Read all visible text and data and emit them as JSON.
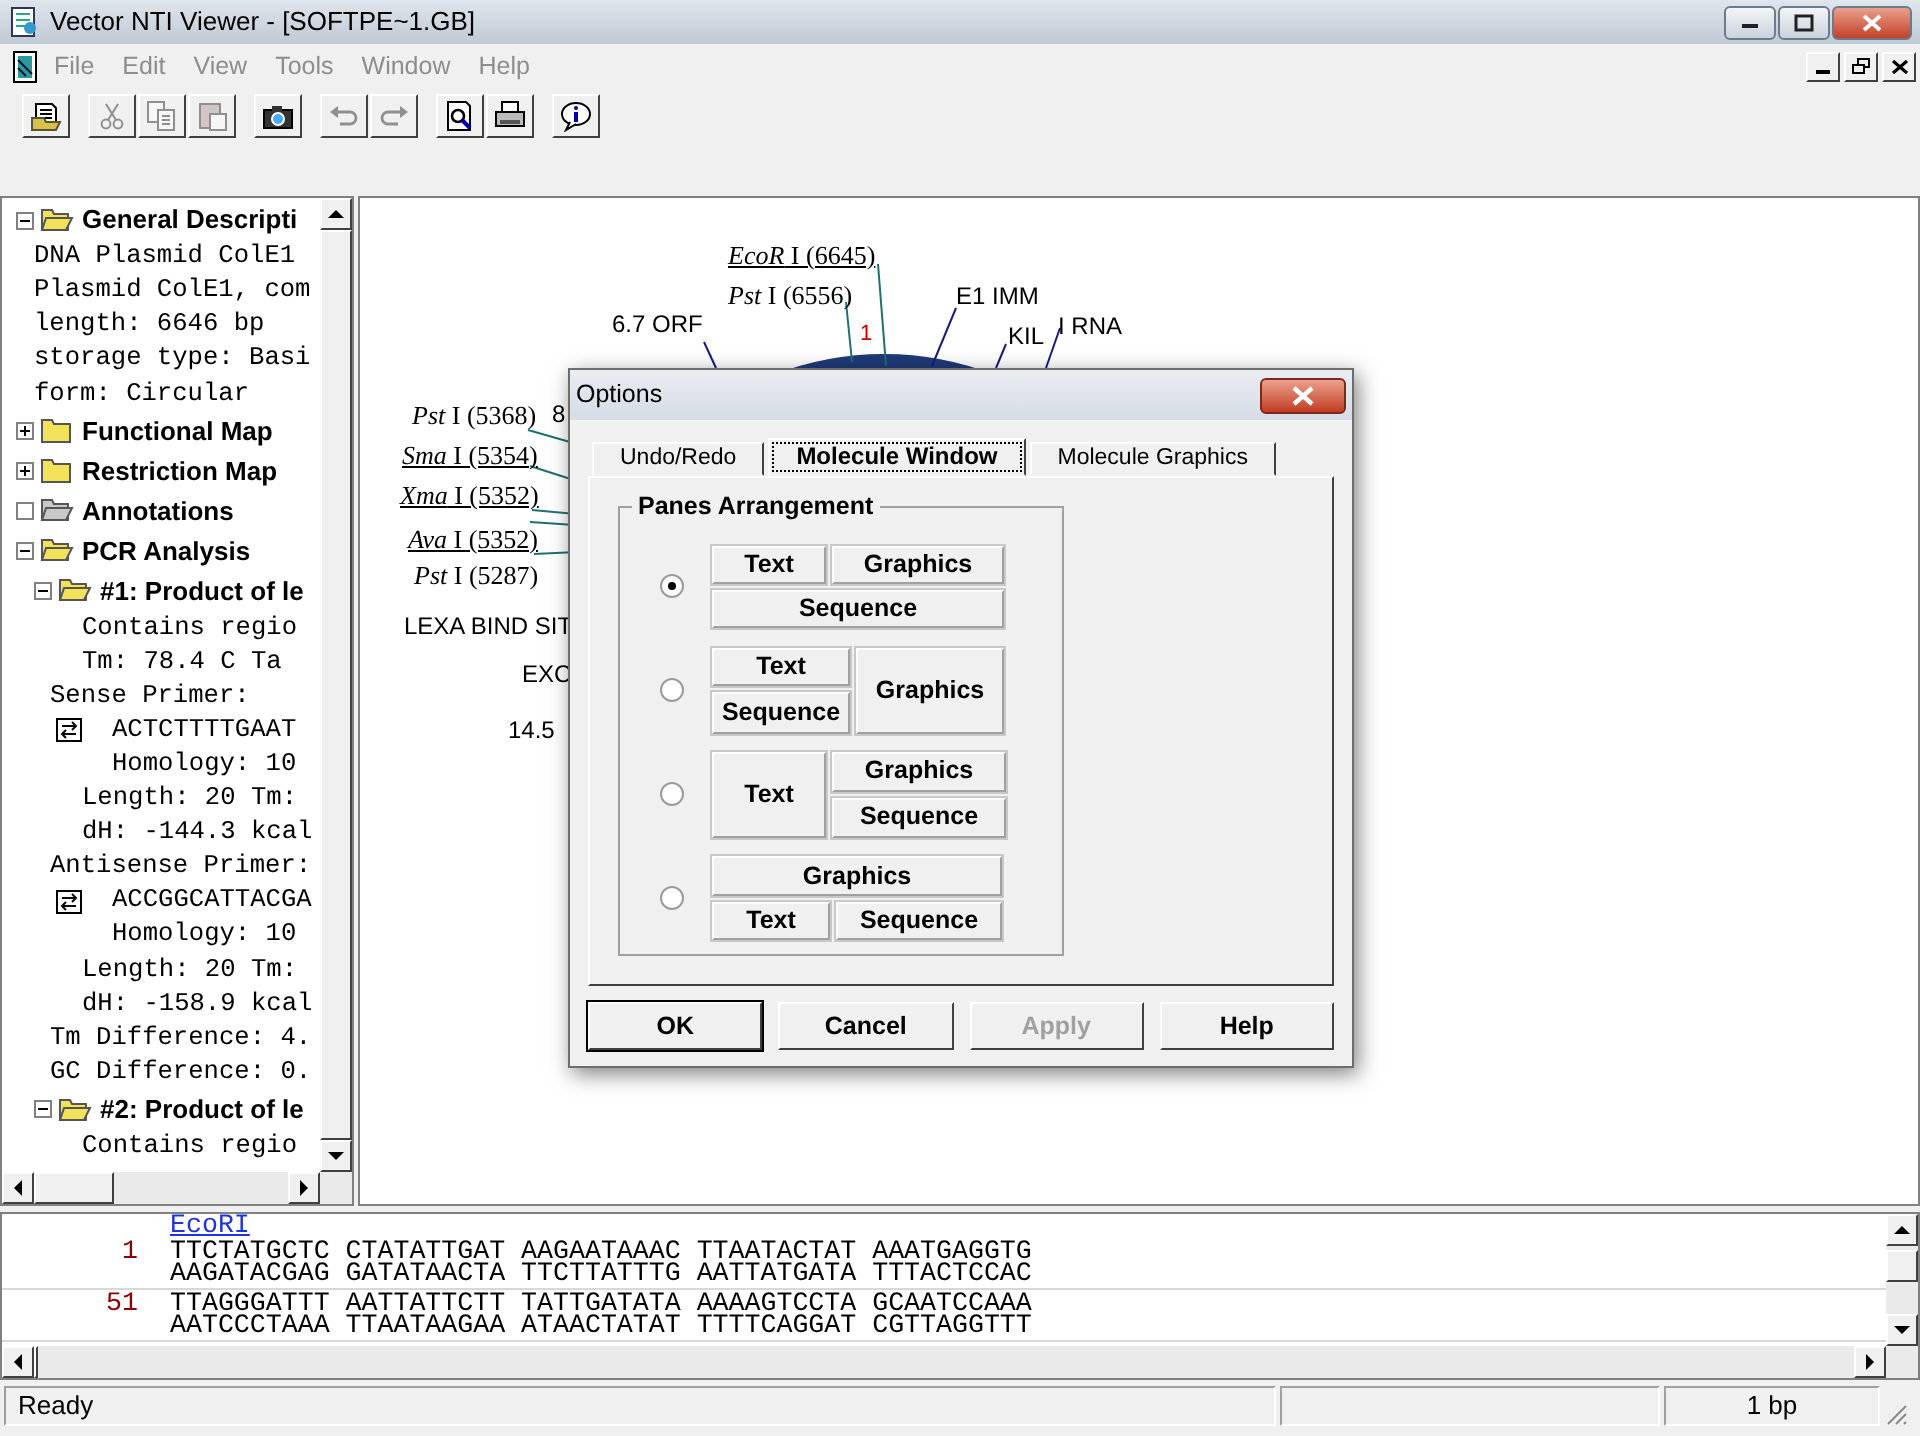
{
  "window": {
    "title": "Vector NTI Viewer - [SOFTPE~1.GB]"
  },
  "menu": [
    {
      "label": "File",
      "disabled": true
    },
    {
      "label": "Edit",
      "disabled": true
    },
    {
      "label": "View",
      "disabled": true
    },
    {
      "label": "Tools",
      "disabled": true
    },
    {
      "label": "Window",
      "disabled": true
    },
    {
      "label": "Help",
      "disabled": true
    }
  ],
  "toolbar": {
    "groups": [
      {
        "buttons": [
          {
            "disabled": false
          }
        ]
      },
      {
        "buttons": [
          {
            "disabled": true
          },
          {
            "disabled": true
          },
          {
            "disabled": true
          }
        ]
      },
      {
        "buttons": [
          {
            "disabled": false
          }
        ]
      },
      {
        "buttons": [
          {
            "disabled": true
          },
          {
            "disabled": true
          }
        ]
      },
      {
        "buttons": [
          {
            "disabled": false
          },
          {
            "disabled": false
          }
        ]
      },
      {
        "buttons": [
          {
            "disabled": false
          }
        ]
      }
    ]
  },
  "tree": [
    {
      "kind": "folder",
      "label": "General Descripti",
      "expanded": true,
      "children": [
        {
          "kind": "line",
          "label": "DNA Plasmid ColE1"
        },
        {
          "kind": "line",
          "label": "Plasmid ColE1, com"
        },
        {
          "kind": "line",
          "label": "length: 6646 bp"
        },
        {
          "kind": "line",
          "label": "storage type: Basi"
        },
        {
          "kind": "line",
          "label": "form: Circular"
        }
      ]
    },
    {
      "kind": "folder",
      "label": "Functional Map",
      "expanded": false
    },
    {
      "kind": "folder",
      "label": "Restriction Map",
      "expanded": false
    },
    {
      "kind": "empty-folder",
      "label": "Annotations",
      "expanded": true
    },
    {
      "kind": "folder",
      "label": "PCR Analysis",
      "expanded": true,
      "children": [
        {
          "kind": "folder",
          "label": "#1: Product of le",
          "expanded": true,
          "children": [
            {
              "kind": "line",
              "label": "Contains regio"
            },
            {
              "kind": "line",
              "label": "Tm: 78.4 C  Ta"
            },
            {
              "kind": "heading",
              "label": "Sense Primer:"
            },
            {
              "kind": "primer",
              "label": "ACTCTTTTGAAT",
              "children": [
                {
                  "kind": "line",
                  "label": "Homology: 10"
                }
              ]
            },
            {
              "kind": "line",
              "label": "Length: 20  Tm:"
            },
            {
              "kind": "line",
              "label": "dH: -144.3 kcal"
            },
            {
              "kind": "heading",
              "label": "Antisense Primer:"
            },
            {
              "kind": "primer",
              "label": "ACCGGCATTACGA",
              "children": [
                {
                  "kind": "line",
                  "label": "Homology: 10"
                }
              ]
            },
            {
              "kind": "line",
              "label": "Length: 20  Tm:"
            },
            {
              "kind": "line",
              "label": "dH: -158.9 kcal"
            },
            {
              "kind": "heading",
              "label": "Tm Difference: 4."
            },
            {
              "kind": "heading",
              "label": "GC Difference: 0."
            }
          ]
        },
        {
          "kind": "folder",
          "label": "#2: Product of le",
          "expanded": true,
          "children": [
            {
              "kind": "line",
              "label": "Contains regio"
            }
          ]
        }
      ]
    }
  ],
  "map": {
    "labels": [
      {
        "kind": "site",
        "text": "*EcoR* I (6645)",
        "underlined": true
      },
      {
        "kind": "site",
        "text": "*Pst* I (6556)",
        "underlined": false
      },
      {
        "kind": "feature",
        "text": "6.7 ORF"
      },
      {
        "kind": "position",
        "text": "1"
      },
      {
        "kind": "feature",
        "text": "E1 IMM"
      },
      {
        "kind": "feature",
        "text": "KIL"
      },
      {
        "kind": "feature",
        "text": "I RNA"
      },
      {
        "kind": "site",
        "text": "*Pst* I (5368)",
        "underlined": false
      },
      {
        "kind": "feature",
        "text": "8"
      },
      {
        "kind": "site",
        "text": "*Sma* I (5354)",
        "underlined": true
      },
      {
        "kind": "site",
        "text": "*Xma* I (5352)",
        "underlined": true
      },
      {
        "kind": "site",
        "text": "*Ava* I (5352)",
        "underlined": true
      },
      {
        "kind": "site",
        "text": "*Pst* I (5287)",
        "underlined": false
      },
      {
        "kind": "feature",
        "text": "LEXA BIND SIT"
      },
      {
        "kind": "feature",
        "text": "EXC"
      },
      {
        "kind": "feature",
        "text": "14.5"
      }
    ]
  },
  "dialog": {
    "title": "Options",
    "tabs": [
      {
        "label": "Undo/Redo",
        "selected": false
      },
      {
        "label": "Molecule Window",
        "selected": true
      },
      {
        "label": "Molecule Graphics",
        "selected": false
      }
    ],
    "group": {
      "title": "Panes Arrangement",
      "options": [
        {
          "kind": "split-top",
          "selected": true,
          "panes": [
            "Text",
            "Graphics",
            "Sequence"
          ]
        },
        {
          "kind": "stack-left",
          "selected": false,
          "panes": [
            "Text",
            "Graphics",
            "Sequence"
          ]
        },
        {
          "kind": "stack-right",
          "selected": false,
          "panes": [
            "Text",
            "Graphics",
            "Sequence"
          ]
        },
        {
          "kind": "split-bottom",
          "selected": false,
          "panes": [
            "Graphics",
            "Text",
            "Sequence"
          ]
        }
      ]
    },
    "buttons": [
      {
        "label": "OK",
        "default": true,
        "disabled": false
      },
      {
        "label": "Cancel",
        "default": false,
        "disabled": false
      },
      {
        "label": "Apply",
        "default": false,
        "disabled": true
      },
      {
        "label": "Help",
        "default": false,
        "disabled": false
      }
    ]
  },
  "sequence": {
    "annotation": "EcoRI",
    "rows": [
      {
        "number": "1",
        "top": "TTCTATGCTC CTATATTGAT AAGAATAAAC TTAATACTAT AAATGAGGTG",
        "bottom": "AAGATACGAG GATATAACTA TTCTTATTTG AATTATGATA TTTACTCCAC"
      },
      {
        "number": "51",
        "top": "TTAGGGATTT AATTATTCTT TATTGATATA AAAAGTCCTA GCAATCCAAA",
        "bottom": "AATCCCTAAA TTAATAAGAA ATAACTATAT TTTTCAGGAT CGTTAGGTTT"
      }
    ]
  },
  "status_bar": {
    "message": "Ready",
    "panel_3": "1 bp"
  }
}
